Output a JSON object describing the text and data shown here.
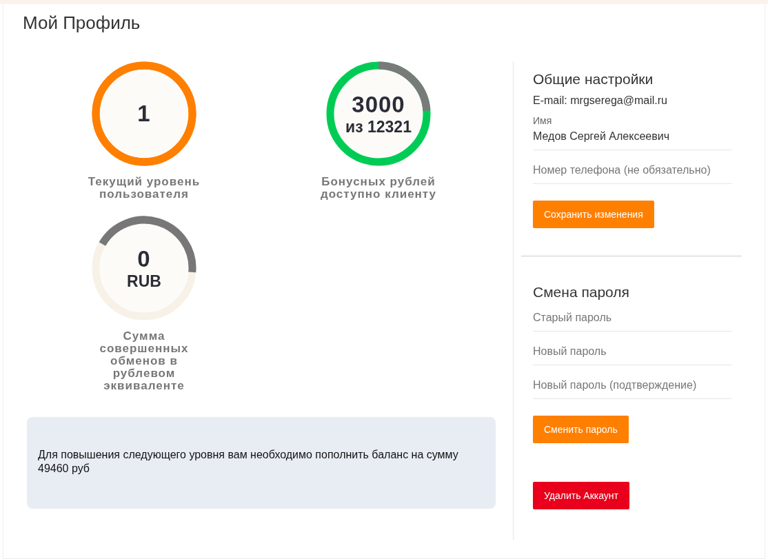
{
  "title": "Мой Профиль",
  "rings": [
    {
      "kind": "level",
      "value": "1",
      "label": "Текущий уровень пользователя"
    },
    {
      "kind": "bonus",
      "value": "3000",
      "unit": "из 12321",
      "label": "Бонусных рублей доступно клиенту"
    },
    {
      "kind": "turnover",
      "value": "0",
      "unit": "RUB",
      "label": "Сумма совершенных обменов в рублевом эквиваленте"
    }
  ],
  "notice": "Для повышения следующего уровня вам необходимо пополнить баланс на сумму 49460 руб",
  "general": {
    "title": "Общие настройки",
    "email": "E-mail: mrgserega@mail.ru",
    "name_label": "Имя",
    "name_value": "Медов Сергей Алексеевич",
    "phone_placeholder": "Номер телефона (не обязательно)",
    "save": "Сохранить изменения"
  },
  "password": {
    "title": "Смена пароля",
    "fields": [
      "Старый пароль",
      "Новый пароль",
      "Новый пароль (подтверждение)"
    ],
    "submit": "Сменить пароль"
  },
  "delete": "Удалить Аккаунт"
}
